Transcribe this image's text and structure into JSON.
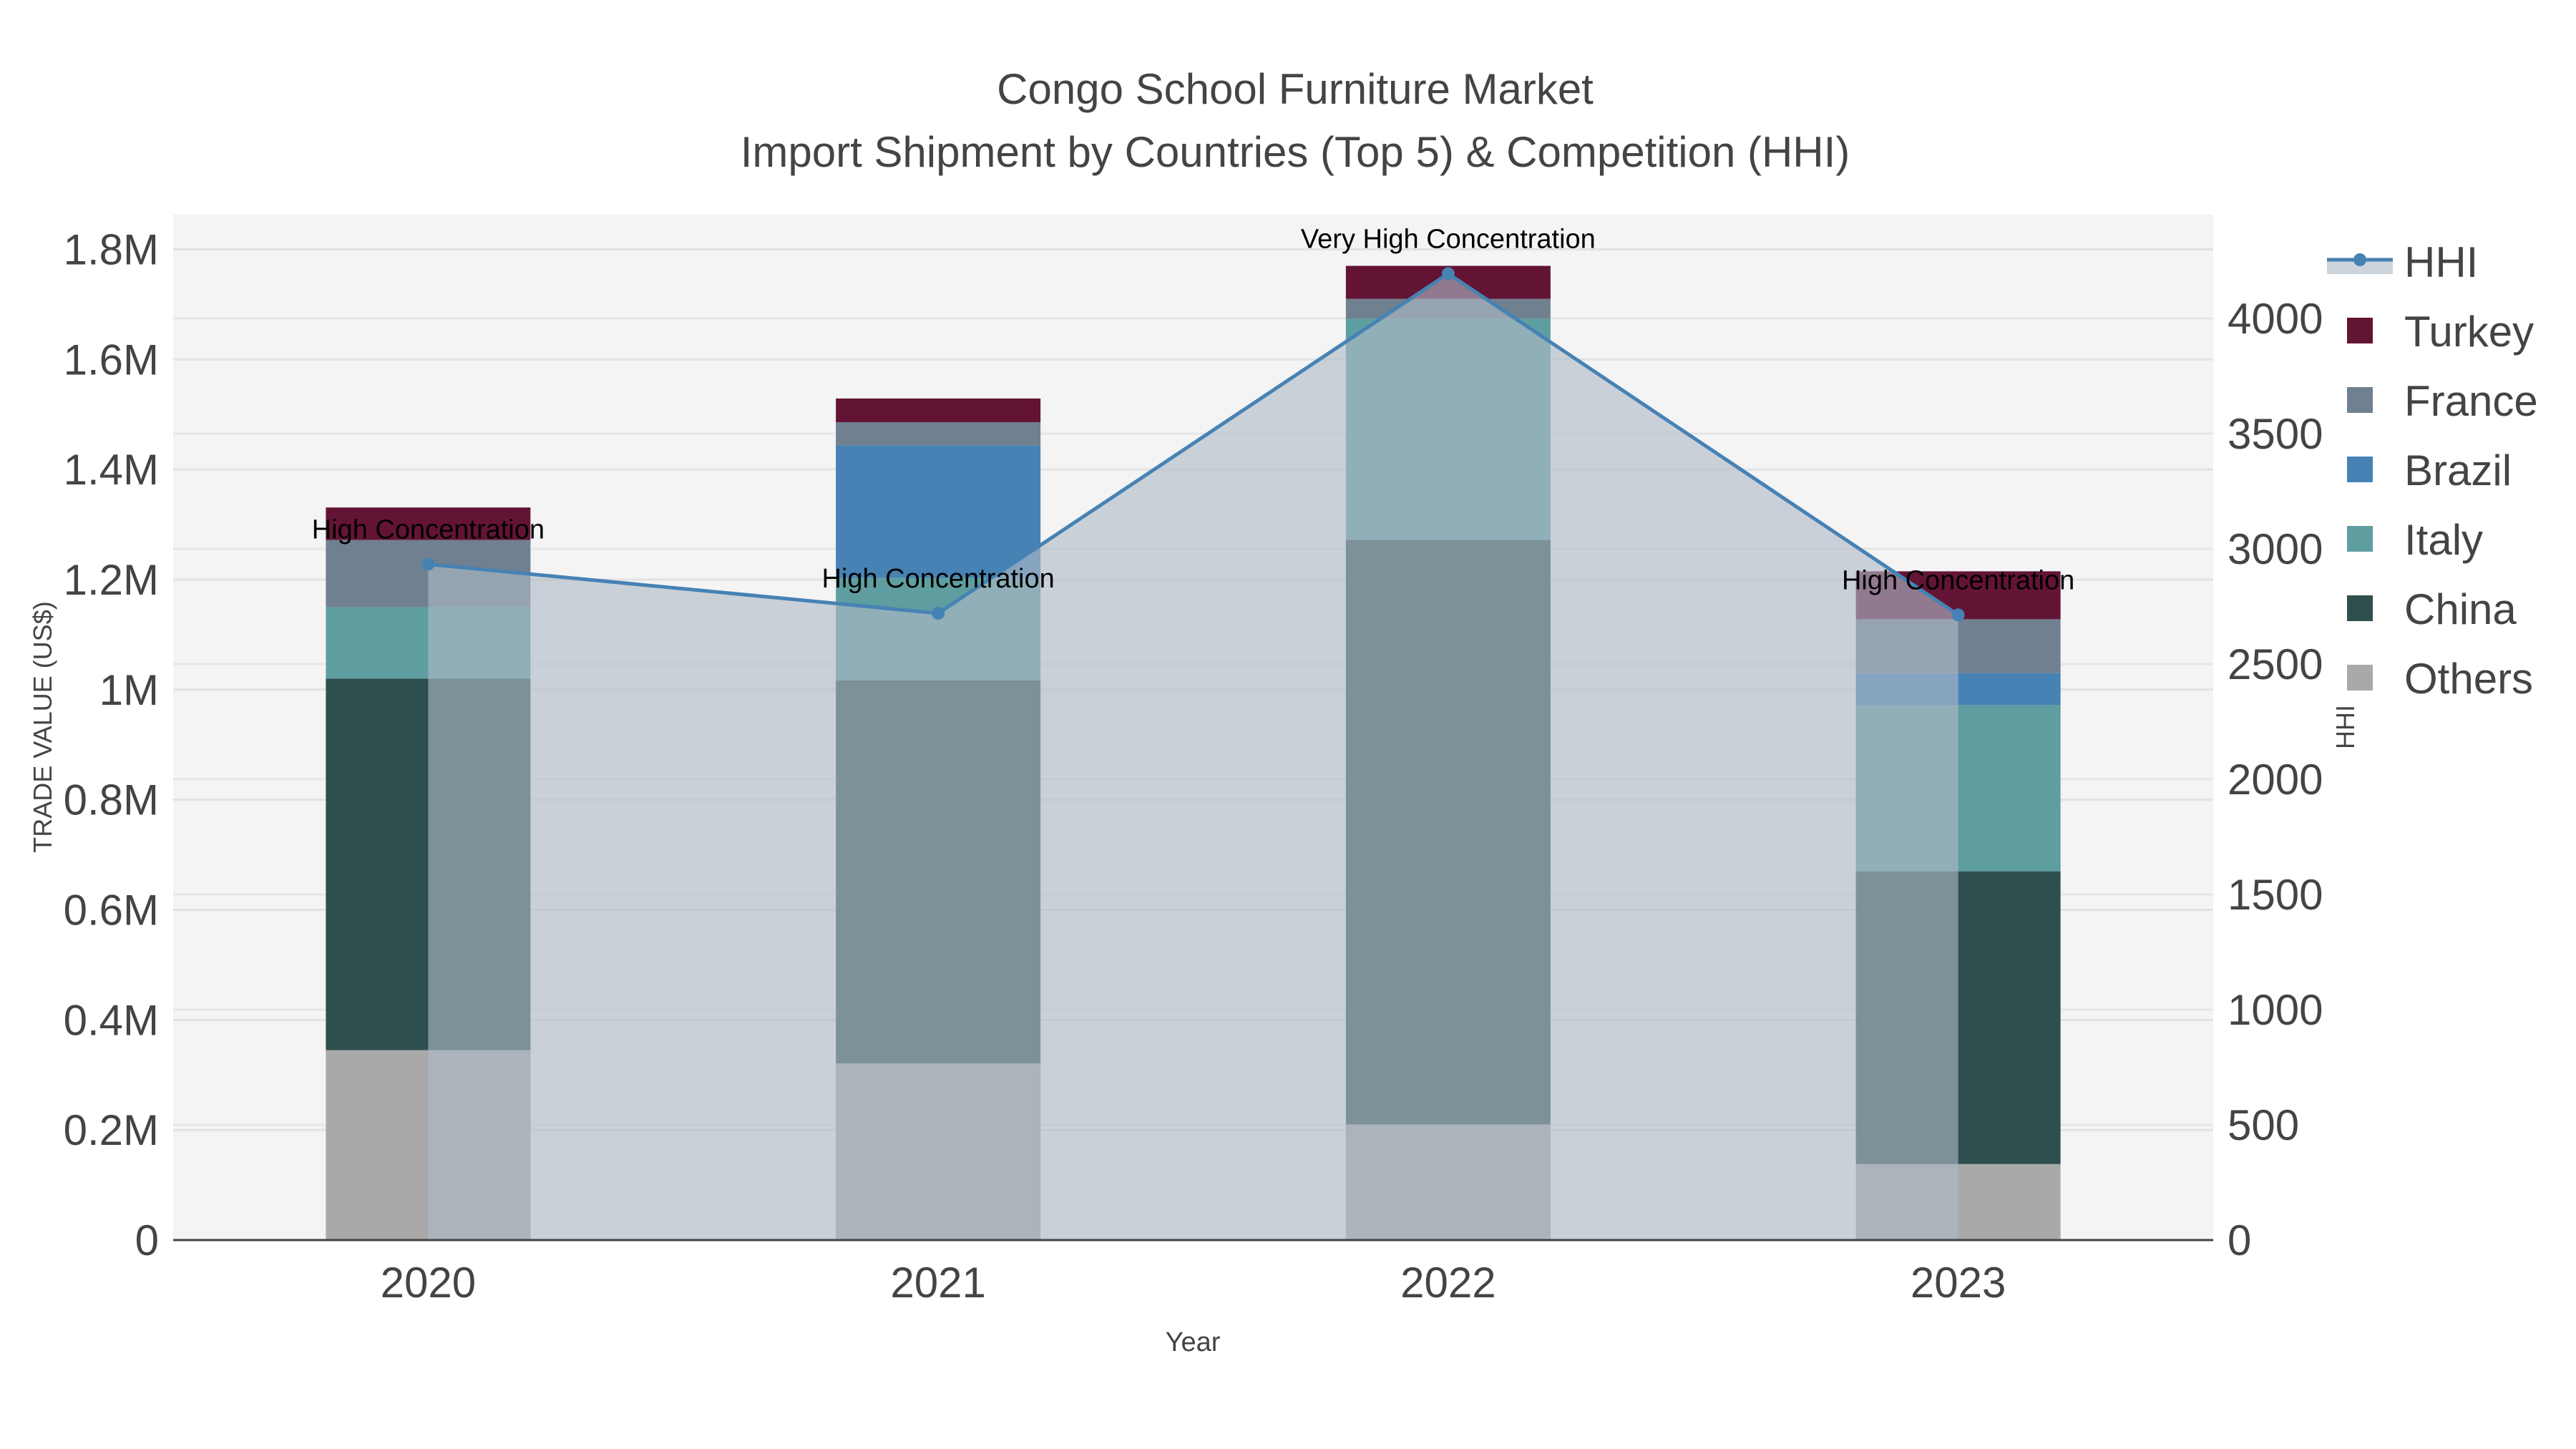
{
  "chart_data": {
    "type": "bar",
    "stacked": true,
    "title": "Congo School Furniture Market",
    "subtitle": "Import Shipment by Countries (Top 5) & Competition (HHI)",
    "xlabel": "Year",
    "ylabel": "TRADE VALUE (US$)",
    "y2label": "HHI",
    "categories": [
      "2020",
      "2021",
      "2022",
      "2023"
    ],
    "ylim": [
      0,
      1.863
    ],
    "y_unit": "M",
    "y_ticks": [
      "0",
      "0.2M",
      "0.4M",
      "0.6M",
      "0.8M",
      "1M",
      "1.2M",
      "1.4M",
      "1.6M",
      "1.8M"
    ],
    "y2lim": [
      0,
      4450
    ],
    "y2_ticks": [
      "0",
      "500",
      "1000",
      "1500",
      "2000",
      "2500",
      "3000",
      "3500",
      "4000"
    ],
    "grid": true,
    "legend_placement": "right",
    "series": [
      {
        "name": "Others",
        "color": "#A9A9A9",
        "values": [
          0.345,
          0.321,
          0.21,
          0.138
        ]
      },
      {
        "name": "China",
        "color": "#2F4F4F",
        "values": [
          0.675,
          0.696,
          1.062,
          0.532
        ]
      },
      {
        "name": "Italy",
        "color": "#5F9EA0",
        "values": [
          0.13,
          0.186,
          0.402,
          0.302
        ]
      },
      {
        "name": "Brazil",
        "color": "#4682B4",
        "values": [
          0,
          0.241,
          0,
          0.058
        ]
      },
      {
        "name": "France",
        "color": "#708090",
        "values": [
          0.122,
          0.042,
          0.036,
          0.098
        ]
      },
      {
        "name": "Turkey",
        "color": "#631435",
        "values": [
          0.059,
          0.043,
          0.06,
          0.087
        ]
      }
    ],
    "line": {
      "name": "HHI",
      "color": "#4682B4",
      "axis": "y2",
      "values": [
        2933,
        2720,
        4194,
        2713
      ]
    },
    "annotations": [
      "High Concentration",
      "High Concentration",
      "Very High Concentration",
      "High Concentration"
    ],
    "legend": [
      "HHI",
      "Turkey",
      "France",
      "Brazil",
      "Italy",
      "China",
      "Others"
    ]
  }
}
